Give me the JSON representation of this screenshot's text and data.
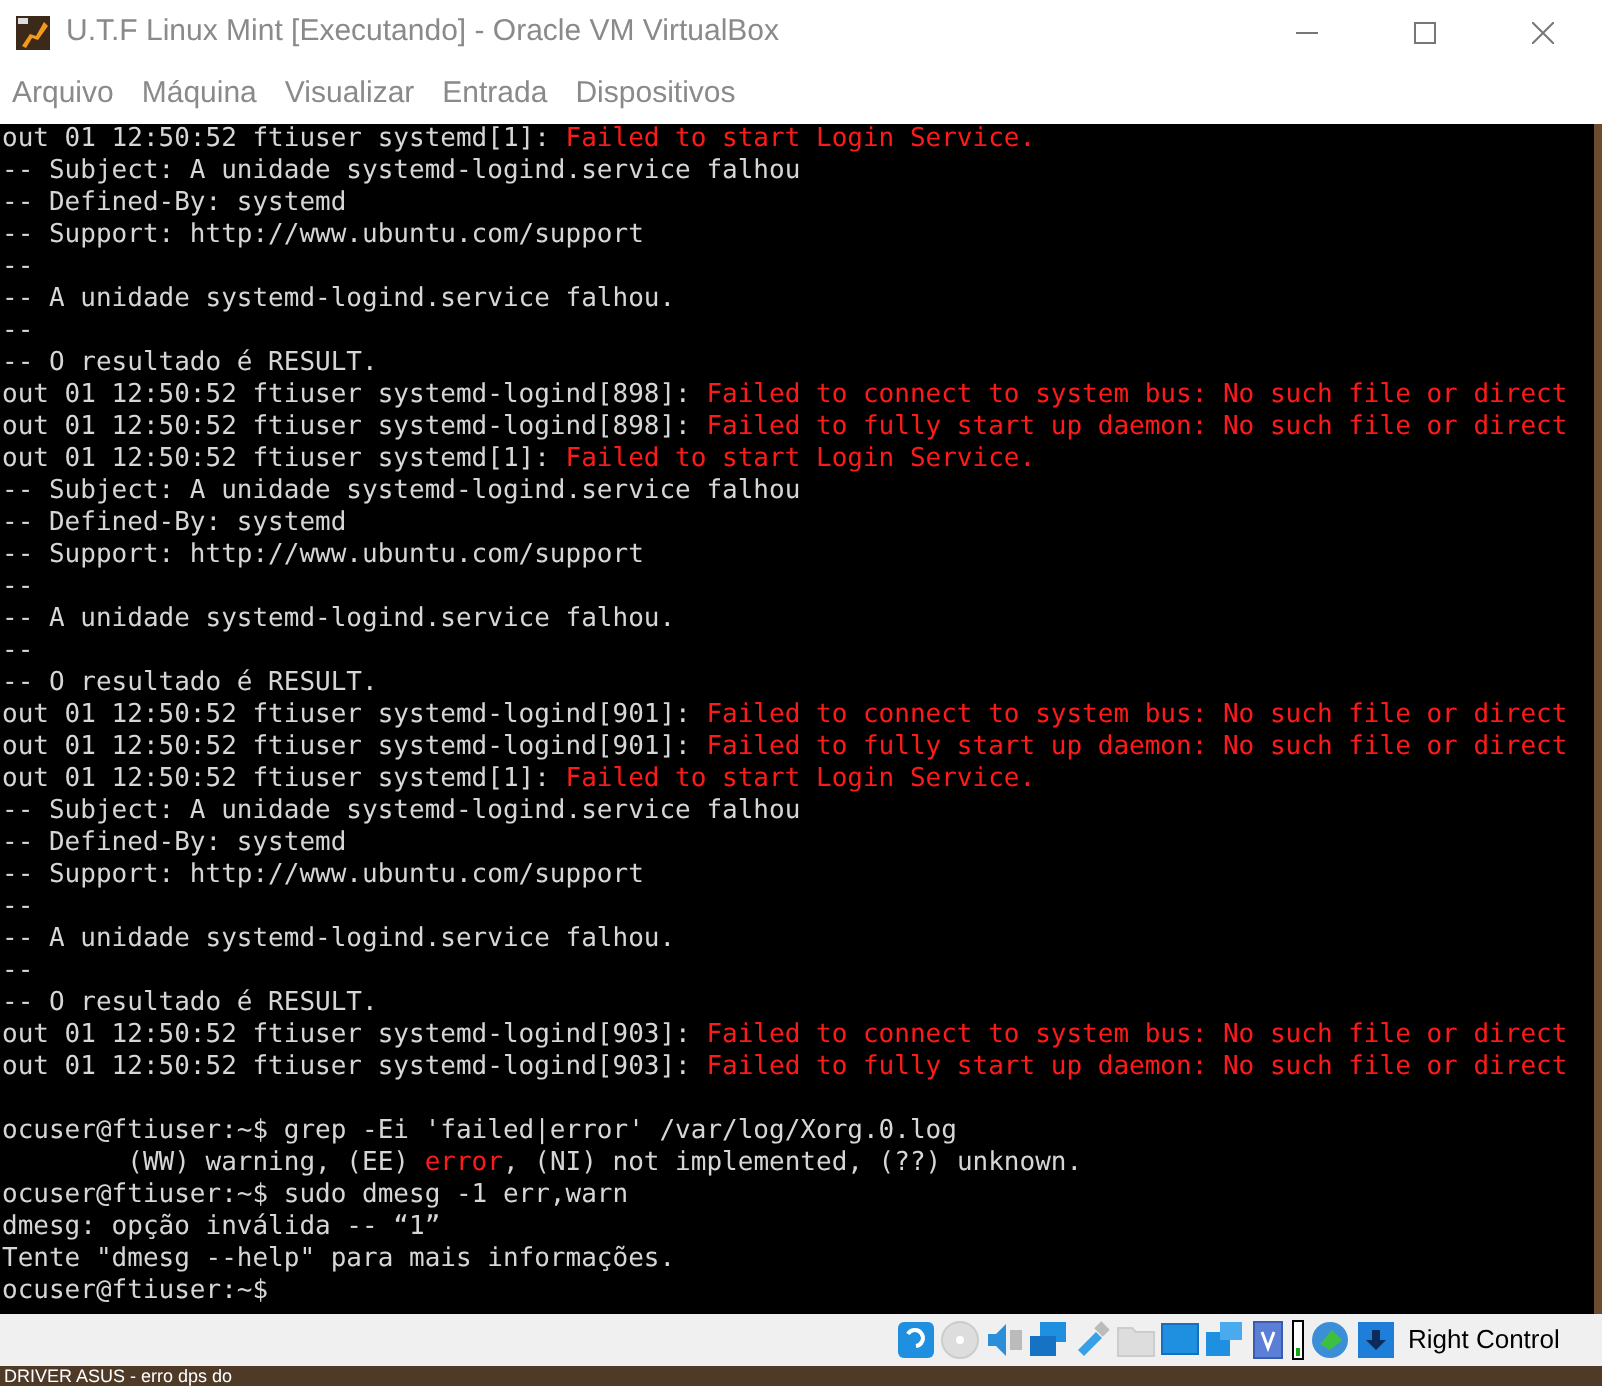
{
  "window": {
    "title": "U.T.F Linux Mint [Executando] - Oracle VM VirtualBox"
  },
  "menu": [
    "Arquivo",
    "Máquina",
    "Visualizar",
    "Entrada",
    "Dispositivos"
  ],
  "terminal": {
    "lines": [
      [
        {
          "kind": "plain",
          "text": "out 01 12:50:52 ftiuser systemd[1]: "
        },
        {
          "kind": "error",
          "text": "Failed to start Login Service."
        }
      ],
      [
        {
          "kind": "plain",
          "text": "-- Subject: A unidade systemd-logind.service falhou"
        }
      ],
      [
        {
          "kind": "plain",
          "text": "-- Defined-By: systemd"
        }
      ],
      [
        {
          "kind": "plain",
          "text": "-- Support: http://www.ubuntu.com/support"
        }
      ],
      [
        {
          "kind": "plain",
          "text": "--"
        }
      ],
      [
        {
          "kind": "plain",
          "text": "-- A unidade systemd-logind.service falhou."
        }
      ],
      [
        {
          "kind": "plain",
          "text": "--"
        }
      ],
      [
        {
          "kind": "plain",
          "text": "-- O resultado é RESULT."
        }
      ],
      [
        {
          "kind": "plain",
          "text": "out 01 12:50:52 ftiuser systemd-logind[898]: "
        },
        {
          "kind": "error",
          "text": "Failed to connect to system bus: No such file or direct"
        }
      ],
      [
        {
          "kind": "plain",
          "text": "out 01 12:50:52 ftiuser systemd-logind[898]: "
        },
        {
          "kind": "error",
          "text": "Failed to fully start up daemon: No such file or direct"
        }
      ],
      [
        {
          "kind": "plain",
          "text": "out 01 12:50:52 ftiuser systemd[1]: "
        },
        {
          "kind": "error",
          "text": "Failed to start Login Service."
        }
      ],
      [
        {
          "kind": "plain",
          "text": "-- Subject: A unidade systemd-logind.service falhou"
        }
      ],
      [
        {
          "kind": "plain",
          "text": "-- Defined-By: systemd"
        }
      ],
      [
        {
          "kind": "plain",
          "text": "-- Support: http://www.ubuntu.com/support"
        }
      ],
      [
        {
          "kind": "plain",
          "text": "--"
        }
      ],
      [
        {
          "kind": "plain",
          "text": "-- A unidade systemd-logind.service falhou."
        }
      ],
      [
        {
          "kind": "plain",
          "text": "--"
        }
      ],
      [
        {
          "kind": "plain",
          "text": "-- O resultado é RESULT."
        }
      ],
      [
        {
          "kind": "plain",
          "text": "out 01 12:50:52 ftiuser systemd-logind[901]: "
        },
        {
          "kind": "error",
          "text": "Failed to connect to system bus: No such file or direct"
        }
      ],
      [
        {
          "kind": "plain",
          "text": "out 01 12:50:52 ftiuser systemd-logind[901]: "
        },
        {
          "kind": "error",
          "text": "Failed to fully start up daemon: No such file or direct"
        }
      ],
      [
        {
          "kind": "plain",
          "text": "out 01 12:50:52 ftiuser systemd[1]: "
        },
        {
          "kind": "error",
          "text": "Failed to start Login Service."
        }
      ],
      [
        {
          "kind": "plain",
          "text": "-- Subject: A unidade systemd-logind.service falhou"
        }
      ],
      [
        {
          "kind": "plain",
          "text": "-- Defined-By: systemd"
        }
      ],
      [
        {
          "kind": "plain",
          "text": "-- Support: http://www.ubuntu.com/support"
        }
      ],
      [
        {
          "kind": "plain",
          "text": "--"
        }
      ],
      [
        {
          "kind": "plain",
          "text": "-- A unidade systemd-logind.service falhou."
        }
      ],
      [
        {
          "kind": "plain",
          "text": "--"
        }
      ],
      [
        {
          "kind": "plain",
          "text": "-- O resultado é RESULT."
        }
      ],
      [
        {
          "kind": "plain",
          "text": "out 01 12:50:52 ftiuser systemd-logind[903]: "
        },
        {
          "kind": "error",
          "text": "Failed to connect to system bus: No such file or direct"
        }
      ],
      [
        {
          "kind": "plain",
          "text": "out 01 12:50:52 ftiuser systemd-logind[903]: "
        },
        {
          "kind": "error",
          "text": "Failed to fully start up daemon: No such file or direct"
        }
      ],
      {
        "kind": "blank"
      },
      [
        {
          "kind": "plain",
          "text": "ocuser@ftiuser:~$ grep -Ei 'failed|error' /var/log/Xorg.0.log"
        }
      ],
      [
        {
          "kind": "plain",
          "text": "        (WW) warning, (EE) "
        },
        {
          "kind": "error",
          "text": "error"
        },
        {
          "kind": "plain",
          "text": ", (NI) not implemented, (??) unknown."
        }
      ],
      [
        {
          "kind": "plain",
          "text": "ocuser@ftiuser:~$ sudo dmesg -1 err,warn"
        }
      ],
      [
        {
          "kind": "plain",
          "text": "dmesg: opção inválida -- “1”"
        }
      ],
      [
        {
          "kind": "plain",
          "text": "Tente \"dmesg --help\" para mais informações."
        }
      ],
      [
        {
          "kind": "plain",
          "text": "ocuser@ftiuser:~$"
        }
      ]
    ]
  },
  "status_bar": {
    "host_key": "Right Control"
  },
  "desktop": {
    "file_label": "DRIVER ASUS - erro dps do"
  }
}
